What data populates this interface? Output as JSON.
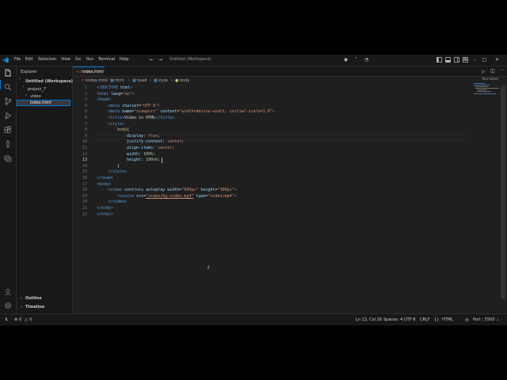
{
  "titlebar": {
    "menus": [
      "File",
      "Edit",
      "Selection",
      "View",
      "Go",
      "Run",
      "Terminal",
      "Help"
    ],
    "workspace_title": "Untitled (Workspace)",
    "nav_icons": [
      "back-arrow-icon",
      "forward-arrow-icon"
    ],
    "right_icons": [
      "copilot-icon",
      "account-icon",
      "layout-icon",
      "toggle-panel-icon",
      "toggle-sidebar-icon",
      "customize-layout-icon"
    ],
    "window_controls": [
      "minimize-icon",
      "maximize-icon",
      "close-icon"
    ]
  },
  "activitybar": {
    "items": [
      "explorer-icon",
      "search-icon",
      "source-control-icon",
      "run-debug-icon",
      "extensions-icon",
      "mongodb-icon",
      "remote-explorer-icon"
    ],
    "bottom": [
      "accounts-icon",
      "settings-gear-icon"
    ]
  },
  "sidebar": {
    "title": "Explorer",
    "workspace": "Untitled (Workspace)",
    "folder": "project_7",
    "items": [
      "video",
      "index.html"
    ],
    "sections": [
      "Outline",
      "Timeline"
    ]
  },
  "editor": {
    "tab_label": "index.html",
    "breadcrumbs": [
      "index.html",
      "html",
      "head",
      "style",
      "body"
    ],
    "right_actions": [
      "run-icon",
      "split-editor-icon",
      "more-actions-icon"
    ],
    "minimap_label": "Text Editor",
    "line_numbers": [
      "1",
      "2",
      "3",
      "4",
      "5",
      "6",
      "7",
      "8",
      "9",
      "10",
      "11",
      "12",
      "13",
      "14",
      "15",
      "16",
      "17",
      "18",
      "19",
      "20",
      "21",
      "22"
    ],
    "code": {
      "l1_a": "<!DOCTYPE ",
      "l1_b": "html",
      "l1_c": ">",
      "l2_a": "<html ",
      "l2_b": "lang",
      "l2_c": "=",
      "l2_d": "\"en\"",
      "l2_e": ">",
      "l3": "<head>",
      "l4_a": "<meta ",
      "l4_b": "charset",
      "l4_c": "=",
      "l4_d": "\"UTF-8\"",
      "l4_e": ">",
      "l5_a": "<meta ",
      "l5_b": "name",
      "l5_c": "=",
      "l5_d": "\"viewport\"",
      "l5_e": " content",
      "l5_f": "=",
      "l5_g": "\"width=device-width, initial-scale=1.0\"",
      "l5_h": ">",
      "l6_a": "<title>",
      "l6_b": "Video in HTML",
      "l6_c": "</title>",
      "l7": "<style>",
      "l8_a": "body",
      "l8_b": "{",
      "l9_a": "display",
      "l9_b": ": ",
      "l9_c": "flex",
      "l9_d": ";",
      "l10_a": "justify-content",
      "l10_b": ": ",
      "l10_c": "center",
      "l10_d": ";",
      "l11_a": "align-items",
      "l11_b": ": ",
      "l11_c": "center",
      "l11_d": ";",
      "l12_a": "width",
      "l12_b": ": ",
      "l12_c": "100%",
      "l12_d": ";",
      "l13_a": "height",
      "l13_b": ": ",
      "l13_c": "100vh",
      "l13_d": ";",
      "l14": "}",
      "l15": "</style>",
      "l16": "</head>",
      "l17": "<body>",
      "l18_a": "<video ",
      "l18_b": "controls autoplay width",
      "l18_c": "=",
      "l18_d": "\"600px\"",
      "l18_e": " height",
      "l18_f": "=",
      "l18_g": "\"300px\"",
      "l18_h": ">",
      "l19_a": "<source ",
      "l19_b": "src",
      "l19_c": "=",
      "l19_d": "\"video/bg-video.mp4\"",
      "l19_e": " type",
      "l19_f": "=",
      "l19_g": "\"video/mp4\"",
      "l19_h": ">",
      "l20": "</video>",
      "l21": "</body>",
      "l22": "</html>"
    }
  },
  "statusbar": {
    "errors": "0",
    "warnings": "0",
    "position": "Ln 13, Col 26",
    "spaces": "Spaces: 4",
    "encoding": "UTF-8",
    "eol": "CRLF",
    "language": "HTML",
    "port": "Port : 5500"
  },
  "colors": {
    "accent": "#0078d4",
    "background": "#1f1f1f",
    "bar": "#181818"
  }
}
